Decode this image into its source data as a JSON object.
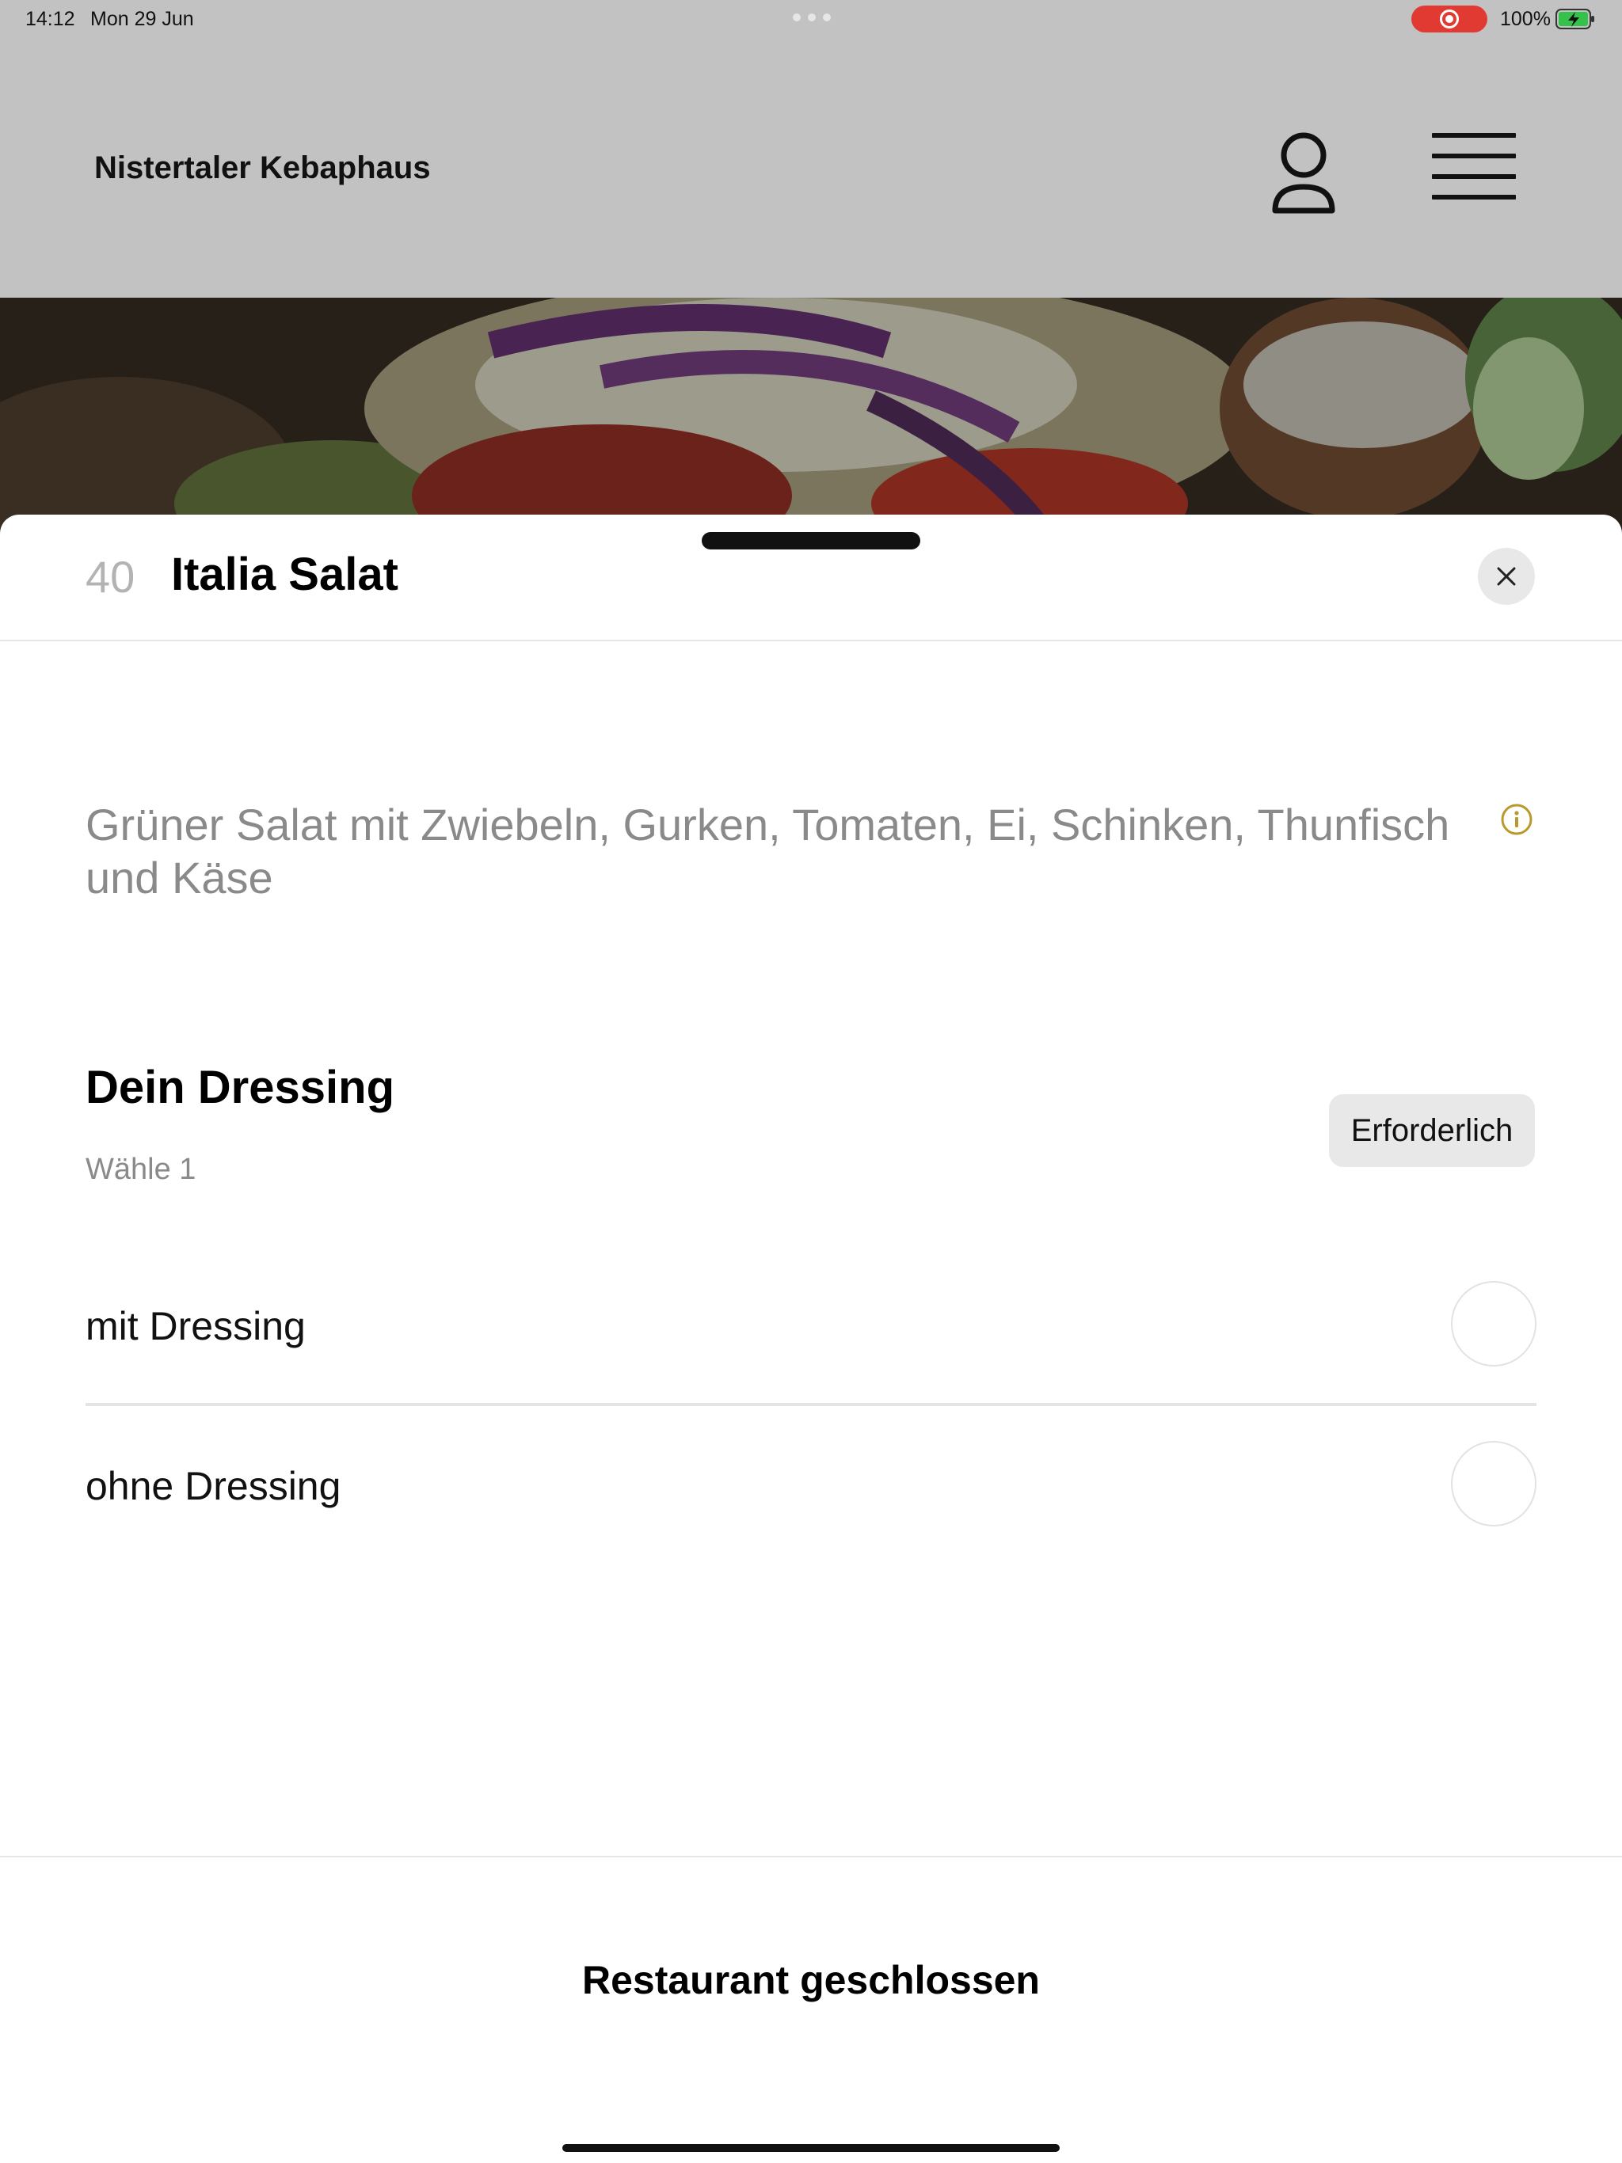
{
  "status_bar": {
    "time": "14:12",
    "date": "Mon 29 Jun",
    "battery": "100%",
    "recording_color": "#e03a32"
  },
  "header": {
    "brand": "Nistertaler Kebaphaus",
    "icons": [
      "person-icon",
      "hamburger-menu-icon"
    ]
  },
  "item": {
    "number": "40",
    "title": "Italia Salat",
    "description": "Grüner Salat mit Zwiebeln, Gurken, Tomaten, Ei, Schinken, Thunfisch und Käse"
  },
  "option_group": {
    "title": "Dein Dressing",
    "subtitle": "Wähle 1",
    "badge": "Erforderlich",
    "options": [
      {
        "label": "mit Dressing",
        "selected": false
      },
      {
        "label": "ohne Dressing",
        "selected": false
      }
    ]
  },
  "footer": {
    "status": "Restaurant geschlossen"
  },
  "colors": {
    "info_icon": "#b89a2a",
    "overlay_header": "#c2c2c2",
    "badge_bg": "#e8e8e8"
  }
}
